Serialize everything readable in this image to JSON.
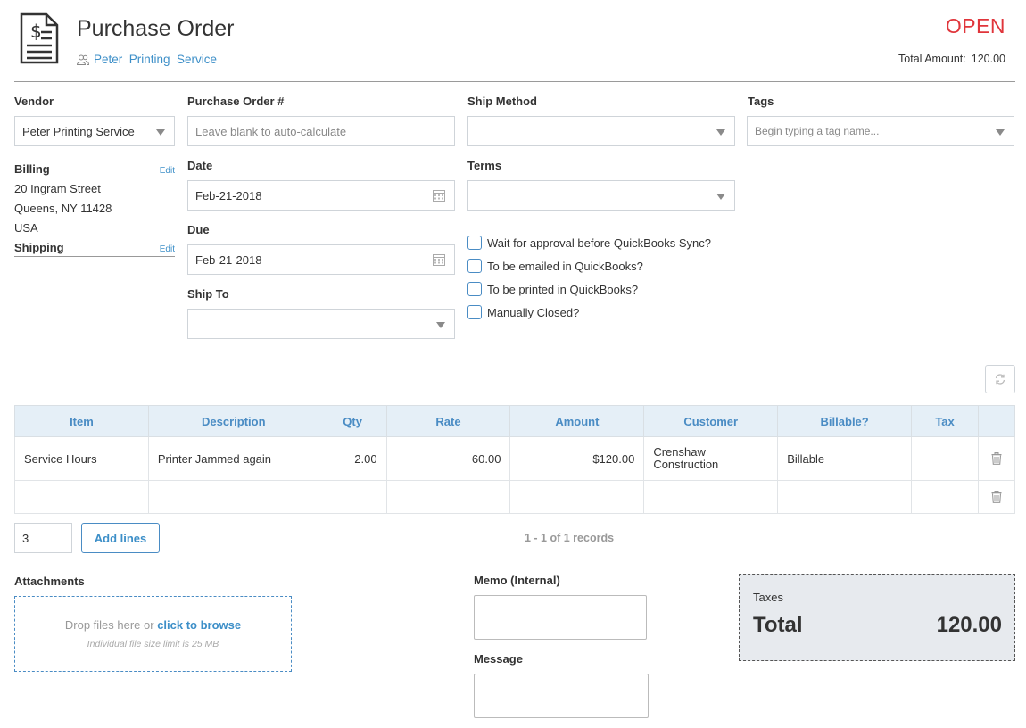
{
  "header": {
    "title": "Purchase Order",
    "vendor_link": "Peter  Printing  Service",
    "status": "OPEN",
    "total_amount_label": "Total Amount:",
    "total_amount_value": "120.00",
    "status_color": "#e0353b",
    "icon": "invoice-document-icon"
  },
  "vendor": {
    "label": "Vendor",
    "value": "Peter Printing Service"
  },
  "billing": {
    "label": "Billing",
    "edit": "Edit",
    "lines": [
      "20 Ingram Street",
      "Queens, NY 11428",
      "USA"
    ]
  },
  "shipping": {
    "label": "Shipping",
    "edit": "Edit"
  },
  "po_number": {
    "label": "Purchase Order #",
    "placeholder": "Leave blank to auto-calculate"
  },
  "date": {
    "label": "Date",
    "value": "Feb-21-2018"
  },
  "due": {
    "label": "Due",
    "value": "Feb-21-2018"
  },
  "ship_to": {
    "label": "Ship To",
    "value": ""
  },
  "ship_method": {
    "label": "Ship Method",
    "value": ""
  },
  "terms": {
    "label": "Terms",
    "value": ""
  },
  "tags": {
    "label": "Tags",
    "placeholder": "Begin typing a tag name..."
  },
  "checkboxes": [
    {
      "label": "Wait for approval before QuickBooks Sync?",
      "checked": false
    },
    {
      "label": "To be emailed in QuickBooks?",
      "checked": false
    },
    {
      "label": "To be printed in QuickBooks?",
      "checked": false
    },
    {
      "label": "Manually Closed?",
      "checked": false
    }
  ],
  "table": {
    "columns": [
      "Item",
      "Description",
      "Qty",
      "Rate",
      "Amount",
      "Customer",
      "Billable?",
      "Tax"
    ],
    "rows": [
      {
        "item": "Service Hours",
        "description": "Printer Jammed again",
        "qty": "2.00",
        "rate": "60.00",
        "amount": "$120.00",
        "customer_1": "Crenshaw",
        "customer_2": "Construction",
        "billable": "Billable",
        "tax": ""
      }
    ]
  },
  "lines_control": {
    "count": "3",
    "add_label": "Add lines",
    "records": "1 - 1 of 1 records"
  },
  "attachments": {
    "label": "Attachments",
    "drop_text": "Drop files here or ",
    "browse_text": "click to browse",
    "limit_text": "Individual file size limit is 25 MB"
  },
  "memo": {
    "label": "Memo (Internal)",
    "value": ""
  },
  "message": {
    "label": "Message",
    "value": ""
  },
  "totals": {
    "taxes_label": "Taxes",
    "total_label": "Total",
    "total_value": "120.00"
  },
  "colors": {
    "accent": "#3d8fc8",
    "table_header_bg": "#e5eff7",
    "totals_bg": "#e7eaee"
  }
}
